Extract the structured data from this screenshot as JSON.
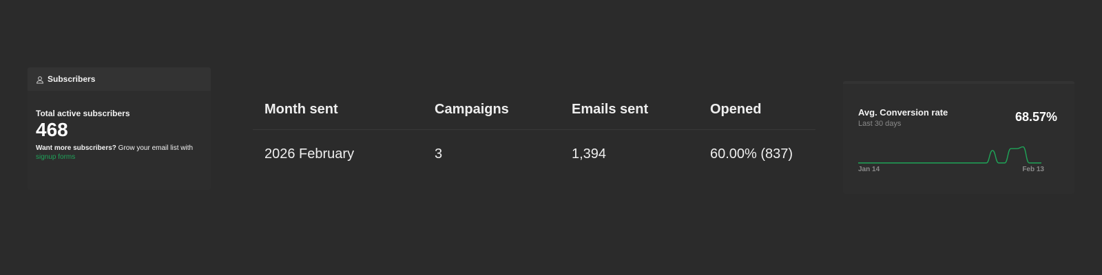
{
  "subscribers": {
    "header_label": "Subscribers",
    "header_icon": "user-icon",
    "total_label": "Total active subscribers",
    "total_value": "468",
    "hint_lead": "Want more subscribers?",
    "hint_rest": " Grow your email list with",
    "link_label": "signup forms",
    "link_color": "#20a35a"
  },
  "table": {
    "headers": [
      "Month sent",
      "Campaigns",
      "Emails sent",
      "Opened"
    ],
    "rows": [
      [
        "2026 February",
        "3",
        "1,394",
        "60.00% (837)"
      ]
    ]
  },
  "conversion": {
    "title": "Avg. Conversion rate",
    "subtitle": "Last 30 days",
    "value": "68.57%",
    "x_start_label": "Jan 14",
    "x_end_label": "Feb 13",
    "line_color": "#1fa558"
  },
  "chart_data": {
    "type": "line",
    "x": [
      "Jan 14",
      "Jan 15",
      "Jan 16",
      "Jan 17",
      "Jan 18",
      "Jan 19",
      "Jan 20",
      "Jan 21",
      "Jan 22",
      "Jan 23",
      "Jan 24",
      "Jan 25",
      "Jan 26",
      "Jan 27",
      "Jan 28",
      "Jan 29",
      "Jan 30",
      "Jan 31",
      "Feb 1",
      "Feb 2",
      "Feb 3",
      "Feb 4",
      "Feb 5",
      "Feb 6",
      "Feb 7",
      "Feb 8",
      "Feb 9",
      "Feb 10",
      "Feb 11",
      "Feb 12",
      "Feb 13"
    ],
    "values": [
      0,
      0,
      0,
      0,
      0,
      0,
      0,
      0,
      0,
      0,
      0,
      0,
      0,
      0,
      0,
      0,
      0,
      0,
      0,
      0,
      0,
      0,
      70,
      0,
      0,
      80,
      80,
      90,
      0,
      0,
      0
    ],
    "ylim": [
      0,
      100
    ],
    "grid": false,
    "legend": "none"
  }
}
